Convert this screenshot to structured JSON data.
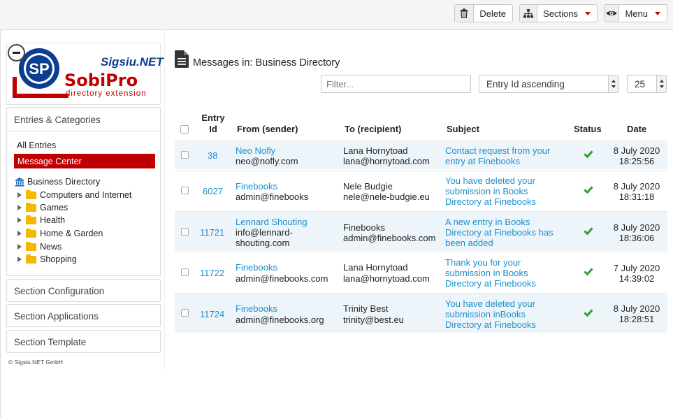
{
  "toolbar": {
    "delete_label": "Delete",
    "sections_label": "Sections",
    "menu_label": "Menu"
  },
  "logo": {
    "sigsiu": "Sigsiu.NET",
    "sobipro": "SobiPro",
    "tagline": "directory extension",
    "sp": "SP"
  },
  "sidebar": {
    "entries_categories": "Entries & Categories",
    "all_entries": "All Entries",
    "message_center": "Message Center",
    "root": "Business Directory",
    "categories": [
      "Computers and Internet",
      "Games",
      "Health",
      "Home & Garden",
      "News",
      "Shopping"
    ],
    "section_configuration": "Section Configuration",
    "section_applications": "Section Applications",
    "section_template": "Section Template",
    "copyright": "© Sigsiu.NET GmbH"
  },
  "page": {
    "title": "Messages in: Business Directory",
    "filter_placeholder": "Filter...",
    "sort_value": "Entry Id ascending",
    "limit_value": "25"
  },
  "table": {
    "headers": {
      "entry_id_1": "Entry",
      "entry_id_2": "Id",
      "from": "From (sender)",
      "to": "To (recipient)",
      "subject": "Subject",
      "status": "Status",
      "date": "Date"
    },
    "rows": [
      {
        "id": "38",
        "from_name": "Neo Nofly",
        "from_email": "neo@nofly.com",
        "to_name": "Lana Hornytoad",
        "to_email": "lana@hornytoad.com",
        "subject": [
          "Contact request from your",
          "entry at Finebooks"
        ],
        "date": "8 July 2020",
        "time": "18:25:56"
      },
      {
        "id": "6027",
        "from_name": "Finebooks",
        "from_email": "admin@finebooks",
        "to_name": "Nele Budgie",
        "to_email": "nele@nele-budgie.eu",
        "subject": [
          "You have deleted your",
          "submission in Books",
          "Directory at Finebooks"
        ],
        "date": "8 July 2020",
        "time": "18:31:18"
      },
      {
        "id": "11721",
        "from_name": "Lennard Shouting",
        "from_email": "info@lennard-",
        "from_email2": "shouting.com",
        "to_name": "Finebooks",
        "to_email": "admin@finebooks.com",
        "subject": [
          "A new entry in Books",
          "Directory at Finebooks has",
          "been added"
        ],
        "date": "8 July 2020",
        "time": "18:36:06"
      },
      {
        "id": "11722",
        "from_name": "Finebooks",
        "from_email": "admin@finebooks.com",
        "to_name": "Lana Hornytoad",
        "to_email": "lana@hornytoad.com",
        "subject": [
          "Thank you for your",
          "submission in Books",
          "Directory at Finebooks"
        ],
        "date": "7 July 2020",
        "time": "14:39:02"
      },
      {
        "id": "11724",
        "from_name": "Finebooks",
        "from_email": "admin@finebooks.org",
        "to_name": "Trinity Best",
        "to_email": "trinity@best.eu",
        "subject": [
          "You have deleted your",
          "submission inBooks",
          "Directory at Finebooks"
        ],
        "date": "8 July 2020",
        "time": "18:28:51"
      }
    ]
  },
  "colors": {
    "accent_red": "#c00000",
    "link_blue": "#1a8fcc",
    "status_green": "#2aa32a",
    "row_stripe": "#eef5fa"
  }
}
